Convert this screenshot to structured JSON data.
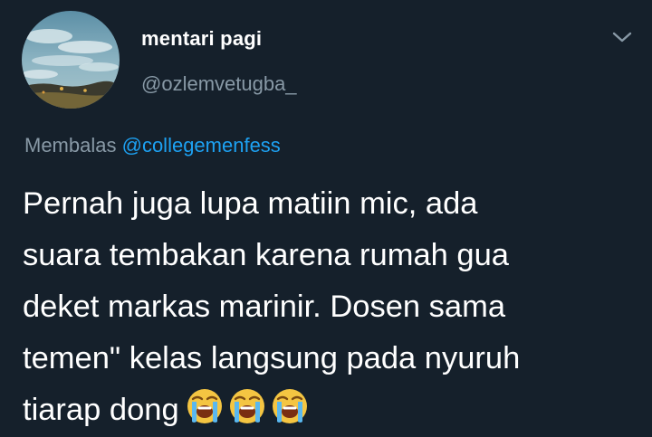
{
  "tweet": {
    "display_name": "mentari pagi",
    "handle": "@ozlemvetugba_",
    "reply_prefix": "Membalas",
    "reply_to": "@collegemenfess",
    "text_lines": [
      "Pernah juga lupa matiin mic, ada",
      "suara tembakan karena rumah gua",
      "deket markas marinir. Dosen sama",
      "temen\" kelas langsung pada nyuruh",
      "tiarap dong"
    ],
    "emojis": [
      "loudly-crying-face",
      "loudly-crying-face",
      "loudly-crying-face"
    ]
  },
  "icons": {
    "menu": "chevron-down-icon",
    "avatar": "sky-landscape-photo"
  },
  "colors": {
    "background": "#15202b",
    "primary_text": "#ffffff",
    "secondary_text": "#8899a6",
    "accent": "#1da1f2",
    "emoji_yellow": "#f4c542"
  }
}
